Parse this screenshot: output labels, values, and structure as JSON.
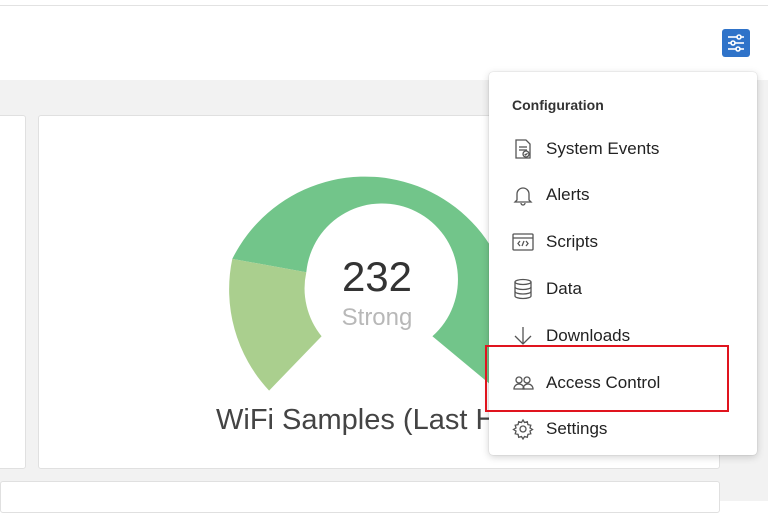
{
  "toolbar": {
    "filter_icon": "sliders-icon"
  },
  "gauge": {
    "value": "232",
    "status": "Strong",
    "title": "WiFi Samples (Last Ho",
    "colors": {
      "strong": "#72c58a",
      "medium": "#aacf8e"
    }
  },
  "menu": {
    "header": "Configuration",
    "items": [
      {
        "label": "System Events",
        "icon": "document-icon"
      },
      {
        "label": "Alerts",
        "icon": "bell-icon"
      },
      {
        "label": "Scripts",
        "icon": "code-window-icon"
      },
      {
        "label": "Data",
        "icon": "database-icon"
      },
      {
        "label": "Downloads",
        "icon": "download-arrow-icon"
      },
      {
        "label": "Access Control",
        "icon": "users-icon"
      },
      {
        "label": "Settings",
        "icon": "gear-icon"
      }
    ]
  },
  "highlight_color": "#e0141e"
}
